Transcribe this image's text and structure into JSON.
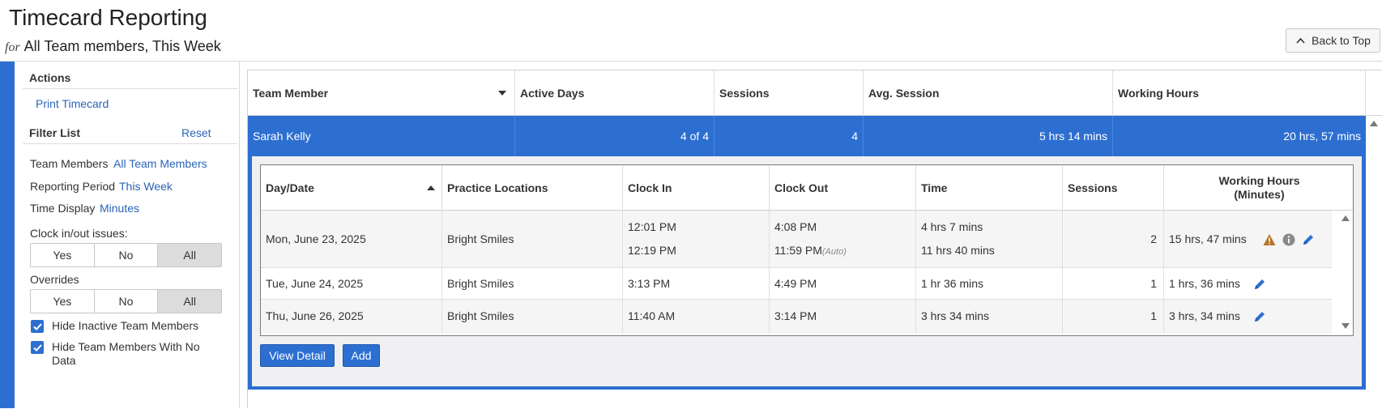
{
  "header": {
    "title": "Timecard Reporting",
    "for_label": "for",
    "subtitle": "All Team members, This Week",
    "back_to_top": "Back to Top"
  },
  "sidebar": {
    "actions_heading": "Actions",
    "print_link": "Print Timecard",
    "filter_heading": "Filter List",
    "reset_link": "Reset",
    "filters": [
      {
        "label": "Team Members",
        "value": "All Team Members"
      },
      {
        "label": "Reporting Period",
        "value": "This Week"
      },
      {
        "label": "Time Display",
        "value": "Minutes"
      }
    ],
    "clock_issues_label": "Clock in/out issues:",
    "clock_options": [
      "Yes",
      "No",
      "All"
    ],
    "overrides_label": "Overrides",
    "override_options": [
      "Yes",
      "No",
      "All"
    ],
    "hide_inactive": "Hide Inactive Team Members",
    "hide_no_data": "Hide Team Members With No Data"
  },
  "summary_table": {
    "columns": [
      "Team Member",
      "Active Days",
      "Sessions",
      "Avg. Session",
      "Working Hours"
    ],
    "selected_row": {
      "team_member": "Sarah Kelly",
      "active_days": "4 of 4",
      "sessions": "4",
      "avg_session": "5 hrs 14 mins",
      "working_hours": "20 hrs, 57 mins"
    }
  },
  "detail_table": {
    "columns": [
      "Day/Date",
      "Practice Locations",
      "Clock In",
      "Clock Out",
      "Time",
      "Sessions",
      "Working Hours (Minutes)"
    ],
    "working_hours_line1": "Working Hours",
    "working_hours_line2": "(Minutes)",
    "auto_tag": "(Auto)",
    "rows": [
      {
        "date": "Mon, June 23, 2025",
        "location": "Bright Smiles",
        "clock_in": [
          "12:01 PM",
          "12:19 PM"
        ],
        "clock_out": [
          "4:08 PM",
          "11:59 PM"
        ],
        "time": [
          "4 hrs 7 mins",
          "11 hrs 40 mins"
        ],
        "sessions": "2",
        "working_hours": "15 hrs, 47 mins"
      },
      {
        "date": "Tue, June 24, 2025",
        "location": "Bright Smiles",
        "clock_in": [
          "3:13 PM"
        ],
        "clock_out": [
          "4:49 PM"
        ],
        "time": [
          "1 hr 36 mins"
        ],
        "sessions": "1",
        "working_hours": "1 hrs, 36 mins"
      },
      {
        "date": "Thu, June 26, 2025",
        "location": "Bright Smiles",
        "clock_in": [
          "11:40 AM"
        ],
        "clock_out": [
          "3:14 PM"
        ],
        "time": [
          "3 hrs 34 mins"
        ],
        "sessions": "1",
        "working_hours": "3 hrs, 34 mins"
      }
    ],
    "buttons": {
      "view_detail": "View Detail",
      "add": "Add"
    }
  },
  "colors": {
    "accent": "#2d6fd1",
    "link": "#2a64b7",
    "warning": "#b8742a"
  }
}
